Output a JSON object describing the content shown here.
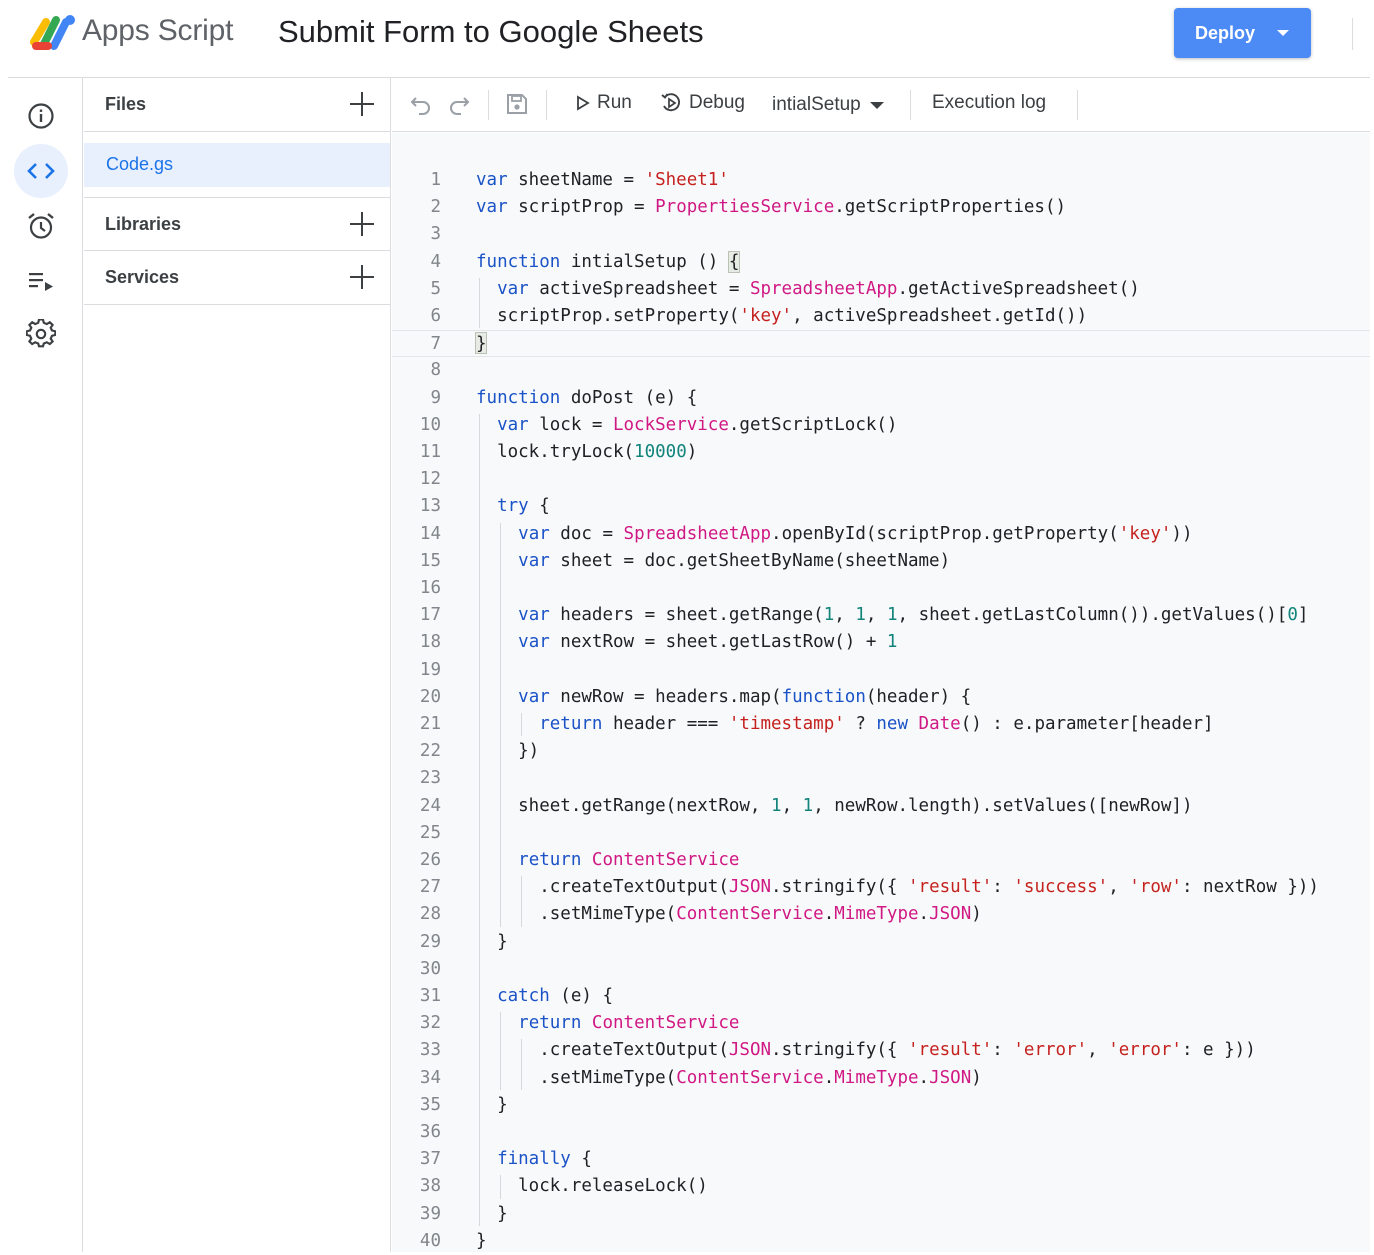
{
  "header": {
    "app_name": "Apps Script",
    "project_title": "Submit Form to Google Sheets",
    "deploy_label": "Deploy"
  },
  "rail": {
    "items": [
      {
        "icon": "info-icon",
        "active": false
      },
      {
        "icon": "code-editor-icon",
        "active": true
      },
      {
        "icon": "alarm-clock-icon",
        "active": false
      },
      {
        "icon": "executions-list-icon",
        "active": false
      },
      {
        "icon": "gear-icon",
        "active": false
      }
    ]
  },
  "files_panel": {
    "files_label": "Files",
    "files": [
      "Code.gs"
    ],
    "libraries_label": "Libraries",
    "services_label": "Services"
  },
  "toolbar": {
    "run_label": "Run",
    "debug_label": "Debug",
    "function_select": "intialSetup",
    "execution_log_label": "Execution log"
  },
  "editor": {
    "lines": [
      "1",
      "2",
      "3",
      "4",
      "5",
      "6",
      "7",
      "8",
      "9",
      "10",
      "11",
      "12",
      "13",
      "14",
      "15",
      "16",
      "17",
      "18",
      "19",
      "20",
      "21",
      "22",
      "23",
      "24",
      "25",
      "26",
      "27",
      "28",
      "29",
      "30",
      "31",
      "32",
      "33",
      "34",
      "35",
      "36",
      "37",
      "38",
      "39",
      "40"
    ],
    "code": [
      "var sheetName = 'Sheet1'",
      "var scriptProp = PropertiesService.getScriptProperties()",
      "",
      "function intialSetup () {",
      "  var activeSpreadsheet = SpreadsheetApp.getActiveSpreadsheet()",
      "  scriptProp.setProperty('key', activeSpreadsheet.getId())",
      "}",
      "",
      "function doPost (e) {",
      "  var lock = LockService.getScriptLock()",
      "  lock.tryLock(10000)",
      "",
      "  try {",
      "    var doc = SpreadsheetApp.openById(scriptProp.getProperty('key'))",
      "    var sheet = doc.getSheetByName(sheetName)",
      "",
      "    var headers = sheet.getRange(1, 1, 1, sheet.getLastColumn()).getValues()[0]",
      "    var nextRow = sheet.getLastRow() + 1",
      "",
      "    var newRow = headers.map(function(header) {",
      "      return header === 'timestamp' ? new Date() : e.parameter[header]",
      "    })",
      "",
      "    sheet.getRange(nextRow, 1, 1, newRow.length).setValues([newRow])",
      "",
      "    return ContentService",
      "      .createTextOutput(JSON.stringify({ 'result': 'success', 'row': nextRow }))",
      "      .setMimeType(ContentService.MimeType.JSON)",
      "  }",
      "",
      "  catch (e) {",
      "    return ContentService",
      "      .createTextOutput(JSON.stringify({ 'result': 'error', 'error': e }))",
      "      .setMimeType(ContentService.MimeType.JSON)",
      "  }",
      "",
      "  finally {",
      "    lock.releaseLock()",
      "  }",
      "}"
    ],
    "current_line": 6
  },
  "colors": {
    "accent": "#4c8bf5",
    "keyword": "#1a52c7",
    "string": "#c5221f",
    "class": "#d01884",
    "number": "#12847c"
  }
}
